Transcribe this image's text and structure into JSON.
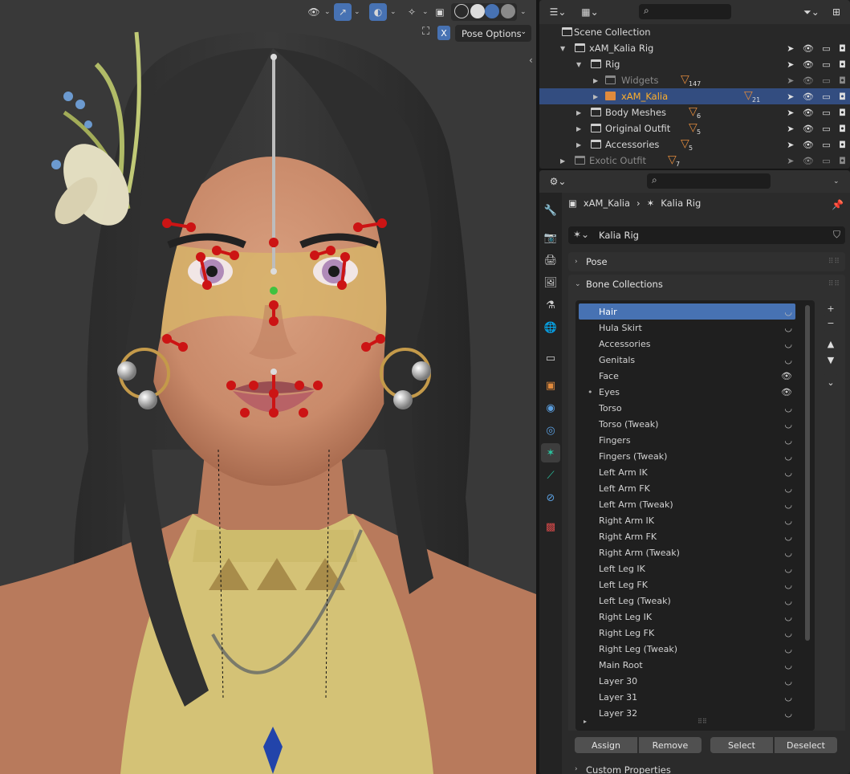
{
  "viewport": {
    "pose_options_label": "Pose Options",
    "mirror_x_label": "X"
  },
  "outliner": {
    "rows": [
      {
        "label": "Scene Collection",
        "indent": 0,
        "state": "normal"
      },
      {
        "label": "xAM_Kalia Rig",
        "indent": 1,
        "state": "normal"
      },
      {
        "label": "Rig",
        "indent": 2,
        "state": "normal"
      },
      {
        "label": "Widgets",
        "indent": 3,
        "state": "dim",
        "count": "147"
      },
      {
        "label": "xAM_Kalia",
        "indent": 3,
        "state": "selected",
        "count": "21"
      },
      {
        "label": "Body Meshes",
        "indent": 2,
        "state": "normal",
        "count": "6"
      },
      {
        "label": "Original Outfit",
        "indent": 2,
        "state": "normal",
        "count": "5"
      },
      {
        "label": "Accessories",
        "indent": 2,
        "state": "normal",
        "count": "5"
      },
      {
        "label": "Exotic Outfit",
        "indent": 1,
        "state": "dim",
        "count": "7"
      }
    ]
  },
  "properties": {
    "breadcrumb_object": "xAM_Kalia",
    "breadcrumb_data": "Kalia Rig",
    "armature_name": "Kalia Rig",
    "pose_panel": "Pose",
    "bone_collections_panel": "Bone Collections",
    "custom_properties_panel": "Custom Properties",
    "bone_collections": [
      {
        "name": "Hair",
        "visible": false,
        "active": true
      },
      {
        "name": "Hula Skirt",
        "visible": false
      },
      {
        "name": "Accessories",
        "visible": false
      },
      {
        "name": "Genitals",
        "visible": false
      },
      {
        "name": "Face",
        "visible": true
      },
      {
        "name": "Eyes",
        "visible": true,
        "has_dot": true
      },
      {
        "name": "Torso",
        "visible": false
      },
      {
        "name": "Torso (Tweak)",
        "visible": false
      },
      {
        "name": "Fingers",
        "visible": false
      },
      {
        "name": "Fingers (Tweak)",
        "visible": false
      },
      {
        "name": "Left Arm IK",
        "visible": false
      },
      {
        "name": "Left Arm FK",
        "visible": false
      },
      {
        "name": "Left Arm (Tweak)",
        "visible": false
      },
      {
        "name": "Right Arm IK",
        "visible": false
      },
      {
        "name": "Right Arm FK",
        "visible": false
      },
      {
        "name": "Right Arm (Tweak)",
        "visible": false
      },
      {
        "name": "Left Leg IK",
        "visible": false
      },
      {
        "name": "Left Leg FK",
        "visible": false
      },
      {
        "name": "Left Leg (Tweak)",
        "visible": false
      },
      {
        "name": "Right Leg IK",
        "visible": false
      },
      {
        "name": "Right Leg FK",
        "visible": false
      },
      {
        "name": "Right Leg (Tweak)",
        "visible": false
      },
      {
        "name": "Main Root",
        "visible": false
      },
      {
        "name": "Layer 30",
        "visible": false
      },
      {
        "name": "Layer 31",
        "visible": false
      },
      {
        "name": "Layer 32",
        "visible": false
      }
    ],
    "buttons": {
      "assign": "Assign",
      "remove": "Remove",
      "select": "Select",
      "deselect": "Deselect"
    }
  },
  "colors": {
    "selection_blue": "#4772b3",
    "outliner_selected": "#334d80",
    "bone_red": "#cc1414",
    "bone_green": "#3fc23f",
    "object_orange": "#ffaf29"
  }
}
